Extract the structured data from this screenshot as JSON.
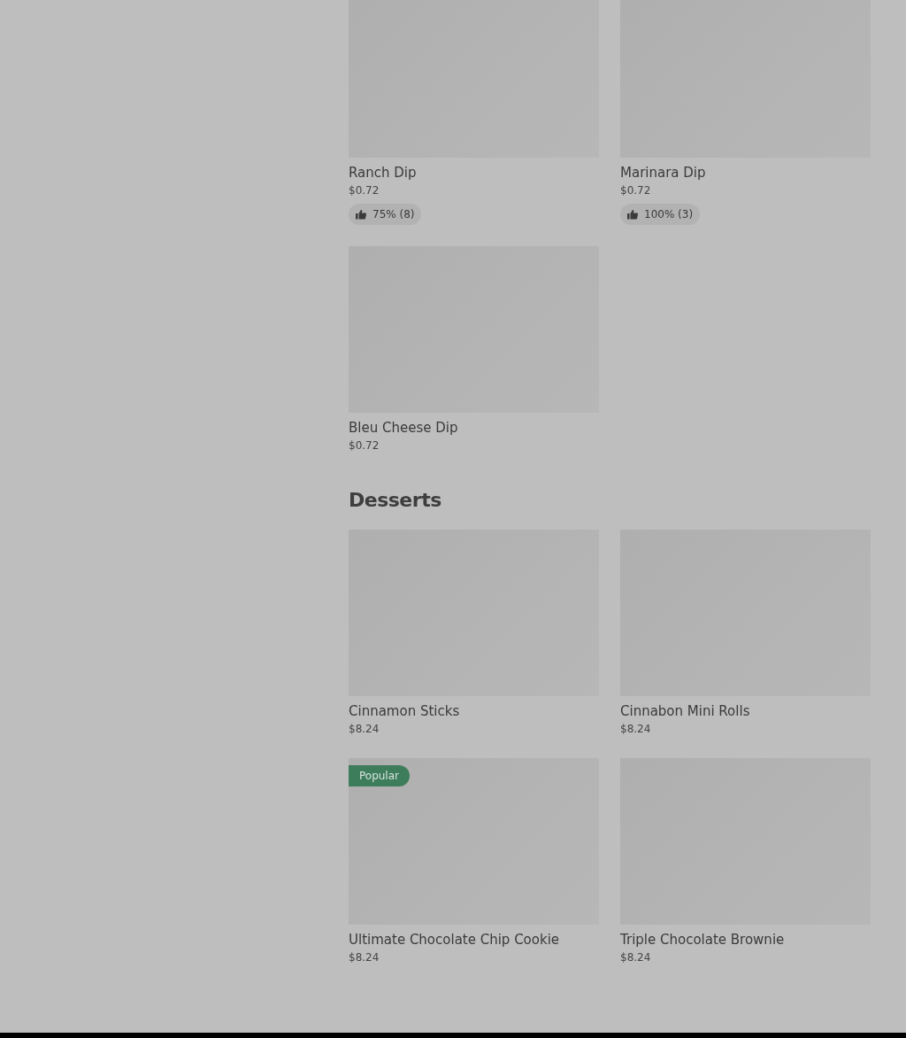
{
  "sections": [
    {
      "items": [
        {
          "name": "Ranch Dip",
          "price": "$0.72",
          "rating": "75% (8)"
        },
        {
          "name": "Marinara Dip",
          "price": "$0.72",
          "rating": "100% (3)"
        },
        {
          "name": "Bleu Cheese Dip",
          "price": "$0.72"
        }
      ]
    },
    {
      "title": "Desserts",
      "items": [
        {
          "name": "Cinnamon Sticks",
          "price": "$8.24"
        },
        {
          "name": "Cinnabon Mini Rolls",
          "price": "$8.24"
        },
        {
          "name": "Ultimate Chocolate Chip Cookie",
          "price": "$8.24",
          "badge": "Popular"
        },
        {
          "name": "Triple Chocolate Brownie",
          "price": "$8.24"
        }
      ]
    }
  ]
}
